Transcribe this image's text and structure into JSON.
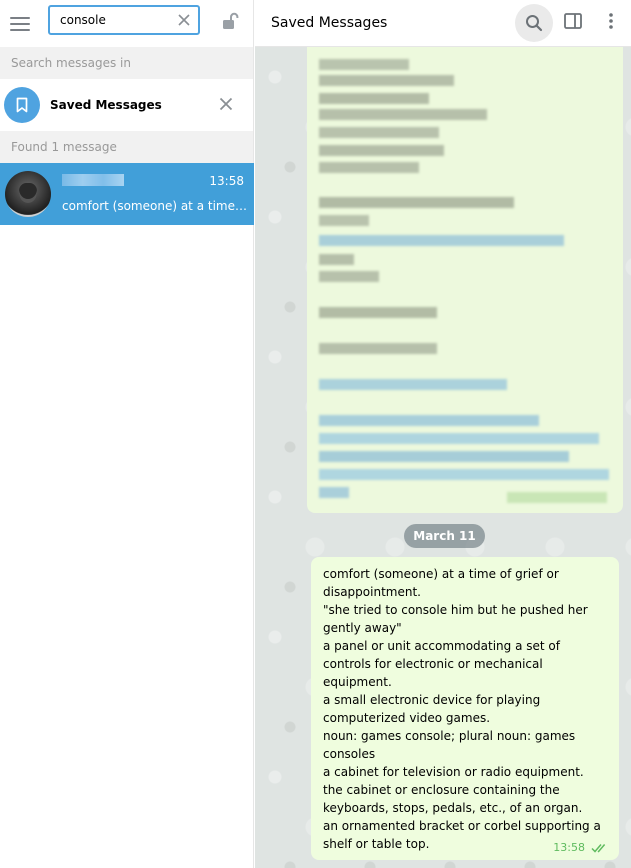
{
  "search": {
    "value": "console",
    "search_in_label": "Search messages in",
    "chat_name": "Saved Messages",
    "found_label": "Found 1 message"
  },
  "result": {
    "time": "13:58",
    "preview": "comfort (someone) at a time of grief or disappointment."
  },
  "chat": {
    "title": "Saved Messages",
    "date_separator": "March 11",
    "message_lines": [
      "comfort (someone) at a time of grief or",
      "disappointment.",
      "\"she tried to console him but he pushed her",
      "gently away\"",
      "a panel or unit accommodating a set of",
      "controls for electronic or mechanical",
      "equipment.",
      "a small electronic device for playing",
      "computerized video games.",
      "noun: games console; plural noun: games",
      "consoles",
      "a cabinet for television or radio equipment.",
      "the cabinet or enclosure containing the",
      "keyboards, stops, pedals, etc., of an organ.",
      "an ornamented bracket or corbel supporting a",
      "shelf or table top."
    ],
    "message_time": "13:58"
  },
  "colors": {
    "accent": "#419fd9",
    "search_border": "#4fa3e0",
    "bubble": "#effdde",
    "check": "#5fbb5f"
  },
  "icons": {
    "menu": "menu-icon",
    "clear": "close-icon",
    "lock": "lock-icon",
    "bookmark": "bookmark-icon",
    "search": "search-icon",
    "sidebar": "sidebar-toggle-icon",
    "more": "more-vertical-icon",
    "read": "double-check-icon"
  }
}
